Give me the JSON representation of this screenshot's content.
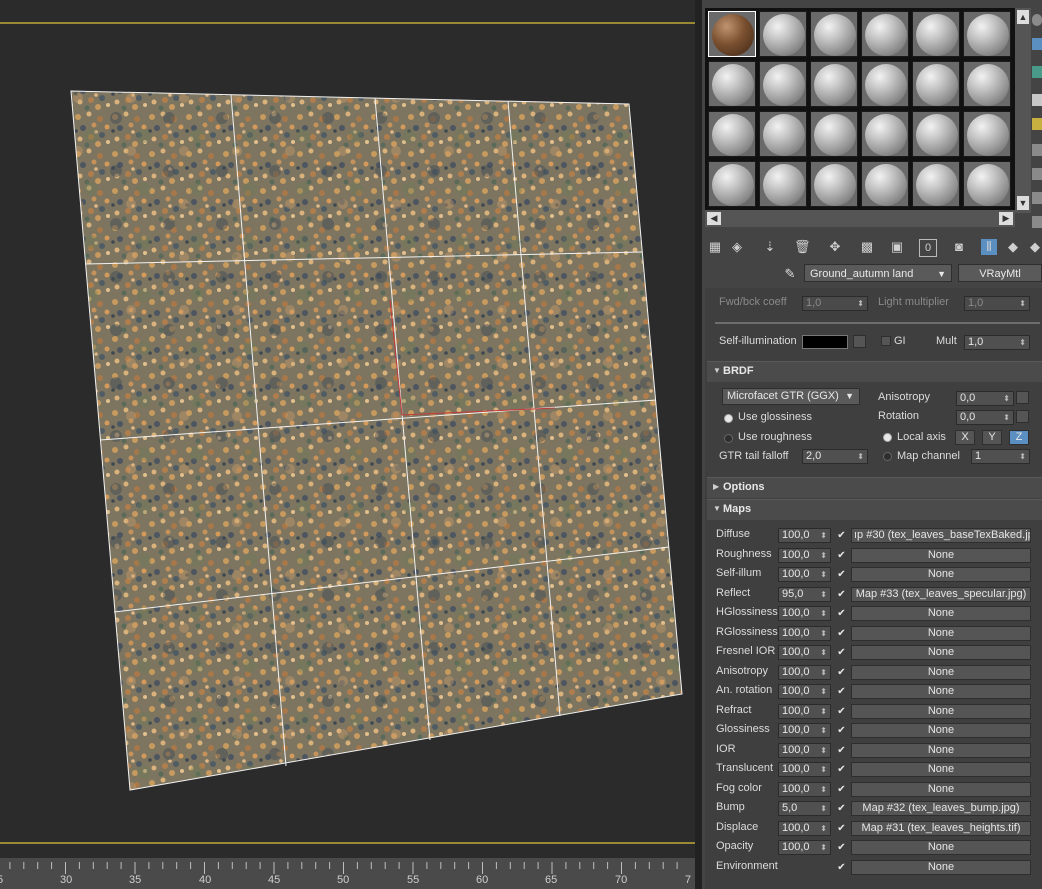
{
  "material_editor": {
    "material_name": "Ground_autumn land",
    "material_type": "VRayMtl"
  },
  "viewport": {
    "ruler_labels": [
      "5",
      "30",
      "35",
      "40",
      "45",
      "50",
      "55",
      "60",
      "65",
      "70",
      "7"
    ]
  },
  "params": {
    "fwd_bck_coeff": {
      "label": "Fwd/bck coeff",
      "value": "1,0"
    },
    "light_multiplier": {
      "label": "Light multiplier",
      "value": "1,0"
    },
    "self_illum": {
      "label": "Self-illumination",
      "gi_label": "GI",
      "mult_label": "Mult",
      "mult_value": "1,0",
      "color": "#000000"
    }
  },
  "brdf": {
    "title": "BRDF",
    "type": "Microfacet GTR (GGX)",
    "use_glossiness": "Use glossiness",
    "use_roughness": "Use roughness",
    "gtr_label": "GTR tail falloff",
    "gtr_value": "2,0",
    "anisotropy_label": "Anisotropy",
    "anisotropy_value": "0,0",
    "rotation_label": "Rotation",
    "rotation_value": "0,0",
    "local_axis": "Local axis",
    "axis_x": "X",
    "axis_y": "Y",
    "axis_z": "Z",
    "map_channel_label": "Map channel",
    "map_channel_value": "1"
  },
  "options": {
    "title": "Options"
  },
  "maps": {
    "title": "Maps",
    "rows": [
      {
        "label": "Diffuse",
        "value": "100,0",
        "map": "ıp #30 (tex_leaves_baseTexBaked.jp"
      },
      {
        "label": "Roughness",
        "value": "100,0",
        "map": "None"
      },
      {
        "label": "Self-illum",
        "value": "100,0",
        "map": "None"
      },
      {
        "label": "Reflect",
        "value": "95,0",
        "map": "Map #33 (tex_leaves_specular.jpg)"
      },
      {
        "label": "HGlossiness",
        "value": "100,0",
        "map": "None"
      },
      {
        "label": "RGlossiness",
        "value": "100,0",
        "map": "None"
      },
      {
        "label": "Fresnel IOR",
        "value": "100,0",
        "map": "None"
      },
      {
        "label": "Anisotropy",
        "value": "100,0",
        "map": "None"
      },
      {
        "label": "An. rotation",
        "value": "100,0",
        "map": "None"
      },
      {
        "label": "Refract",
        "value": "100,0",
        "map": "None"
      },
      {
        "label": "Glossiness",
        "value": "100,0",
        "map": "None"
      },
      {
        "label": "IOR",
        "value": "100,0",
        "map": "None"
      },
      {
        "label": "Translucent",
        "value": "100,0",
        "map": "None"
      },
      {
        "label": "Fog color",
        "value": "100,0",
        "map": "None"
      },
      {
        "label": "Bump",
        "value": "5,0",
        "map": "Map #32 (tex_leaves_bump.jpg)"
      },
      {
        "label": "Displace",
        "value": "100,0",
        "map": "Map #31 (tex_leaves_heights.tif)"
      },
      {
        "label": "Opacity",
        "value": "100,0",
        "map": "None"
      },
      {
        "label": "Environment",
        "value": "",
        "map": "None"
      }
    ]
  },
  "colors": {
    "viewport_bg": "#2b2b2b",
    "panel_bg": "#444444",
    "accent": "#5b8fc2",
    "viewport_border": "#9a8a34"
  }
}
